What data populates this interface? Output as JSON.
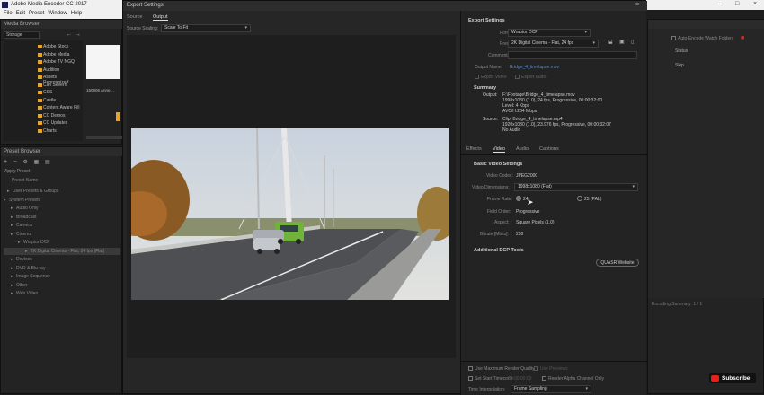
{
  "app": {
    "title": "Adobe Media Encoder CC 2017",
    "menu": [
      "File",
      "Edit",
      "Preset",
      "Window",
      "Help"
    ],
    "window_controls": [
      "–",
      "□",
      "×"
    ]
  },
  "media_browser": {
    "header": "Media Browser",
    "location": "Storage",
    "folders": [
      "Adobe Stock",
      "Adobe Media",
      "Adobe TV NGQ",
      "Audition",
      "Assets Reorganized",
      "Carl Severn",
      "CSS",
      "Castle",
      "Content Aware Fill",
      "CC Demos",
      "CC Updates",
      "Charts"
    ],
    "thumb_label": "150906 Anne…"
  },
  "preset_browser": {
    "header": "Preset Browser",
    "apply_label": "Apply Preset",
    "col_header": "Preset Name",
    "groups": [
      {
        "label": "User Presets & Groups"
      },
      {
        "label": "System Presets"
      },
      {
        "label": "Audio Only"
      },
      {
        "label": "Broadcast"
      },
      {
        "label": "Camera"
      },
      {
        "label": "Cinema"
      },
      {
        "label": "Wraptor DCP"
      },
      {
        "label": "2K Digital Cinema - Flat, 24 fps (Flat)"
      },
      {
        "label": "Devices"
      },
      {
        "label": "DVD & Blu-ray"
      },
      {
        "label": "Image Sequence"
      },
      {
        "label": "Other"
      },
      {
        "label": "Web Video"
      }
    ]
  },
  "queue_panel": {
    "auto_encode": "Auto-Encode Watch Folders",
    "status_header": "Status",
    "status": "Skip",
    "encoding_note": "Encoding Summary: 1 / 1"
  },
  "dialog": {
    "title": "Export Settings",
    "tabs": [
      "Source",
      "Output"
    ],
    "source_scaling_label": "Source Scaling:",
    "source_scaling_value": "Scale To Fit",
    "export_settings_header": "Export Settings",
    "format_label": "Format:",
    "format_value": "Wraptor DCP",
    "preset_label": "Preset:",
    "preset_value": "2K Digital Cinema - Flat, 24 fps",
    "comments_label": "Comments:",
    "output_name_label": "Output Name:",
    "output_name_value": "Bridge_4_timelapse.mov",
    "export_video": "Export Video",
    "export_audio": "Export Audio",
    "summary_header": "Summary",
    "output_label": "Output:",
    "output_lines": [
      "F:\\Footage\\Bridge_4_timelapse.mov",
      "1998x1080 (1.0), 24 fps, Progressive, 00:00:32:00",
      "Level: 4 Kbps",
      "AVC/H.264 Mbps"
    ],
    "source_label": "Source:",
    "source_lines": [
      "Clip, Bridge_4_timelapse.mp4",
      "1920x1080 (1.0), 23.976 fps, Progressive, 00:00:32:07",
      "No Audio"
    ],
    "settings_tabs": [
      "Effects",
      "Video",
      "Audio",
      "Captions"
    ],
    "basic_video_header": "Basic Video Settings",
    "video_codec_label": "Video Codec:",
    "video_codec_value": "JPEG2000",
    "video_dimensions_label": "Video Dimensions:",
    "video_dimensions_value": "1998x1080 (Flat)",
    "frame_rate_label": "Frame Rate:",
    "fr_option_1": "24",
    "fr_option_2": "25 (PAL)",
    "field_order_label": "Field Order:",
    "field_order_value": "Progressive",
    "aspect_label": "Aspect:",
    "aspect_value": "Square Pixels (1.0)",
    "bitrate_label": "Bitrate [Mbits]:",
    "bitrate_value": "250",
    "additional_header": "Additional DCP Tools",
    "quasr_button": "QUASR Website",
    "use_max_quality": "Use Maximum Render Quality",
    "use_previews": "Use Previews",
    "set_start_tc": "Set Start Timecode",
    "start_tc_value": "00:00:00:00",
    "render_alpha": "Render Alpha Channel Only",
    "time_interp_label": "Time Interpolation:",
    "time_interp_value": "Frame Sampling"
  },
  "youtube": {
    "subscribe": "Subscribe"
  }
}
